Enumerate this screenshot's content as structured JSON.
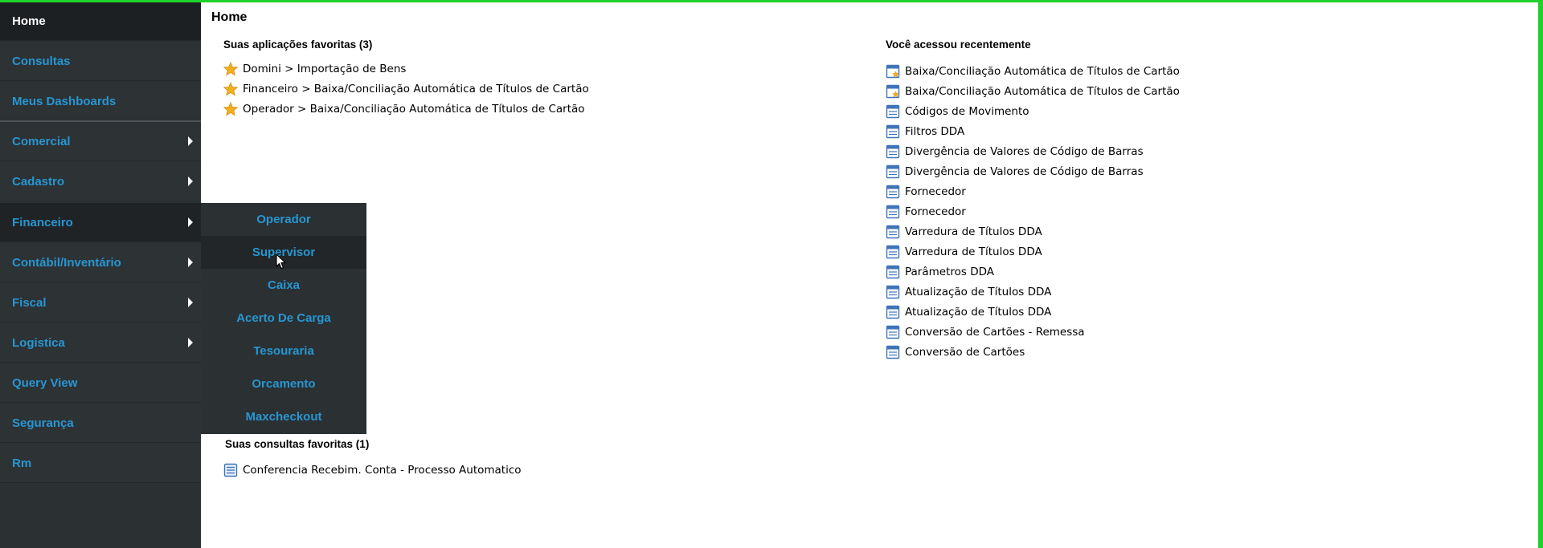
{
  "sidebar": {
    "items": [
      {
        "label": "Home"
      },
      {
        "label": "Consultas"
      },
      {
        "label": "Meus Dashboards"
      },
      {
        "label": "Comercial"
      },
      {
        "label": "Cadastro"
      },
      {
        "label": "Financeiro"
      },
      {
        "label": "Contábil/Inventário"
      },
      {
        "label": "Fiscal"
      },
      {
        "label": "Logistica"
      },
      {
        "label": "Query View"
      },
      {
        "label": "Segurança"
      },
      {
        "label": "Rm"
      }
    ]
  },
  "submenu": {
    "items": [
      {
        "label": "Operador"
      },
      {
        "label": "Supervisor"
      },
      {
        "label": "Caixa"
      },
      {
        "label": "Acerto De Carga"
      },
      {
        "label": "Tesouraria"
      },
      {
        "label": "Orcamento"
      },
      {
        "label": "Maxcheckout"
      }
    ]
  },
  "main": {
    "title": "Home",
    "favorites": {
      "title": "Suas aplicações favoritas (3)",
      "items": [
        "Domini > Importação de Bens",
        "Financeiro > Baixa/Conciliação Automática de Títulos de Cartão",
        "Operador > Baixa/Conciliação Automática de Títulos de Cartão"
      ]
    },
    "recent": {
      "title": "Você acessou recentemente",
      "items": [
        "Baixa/Conciliação Automática de Títulos de Cartão",
        "Baixa/Conciliação Automática de Títulos de Cartão",
        "Códigos de Movimento",
        "Filtros DDA",
        "Divergência de Valores de Código de Barras",
        "Divergência de Valores de Código de Barras",
        "Fornecedor",
        "Fornecedor",
        "Varredura de Títulos DDA",
        "Varredura de Títulos DDA",
        "Parâmetros DDA",
        "Atualização de Títulos DDA",
        "Atualização de Títulos DDA",
        "Conversão de Cartões - Remessa",
        "Conversão de Cartões"
      ]
    },
    "queries": {
      "title": "Suas consultas favoritas (1)",
      "items": [
        "Conferencia Recebim. Conta - Processo Automatico"
      ]
    }
  },
  "colors": {
    "sidebar_bg": "#2b3033",
    "link_blue": "#2796d2",
    "window_border": "#1fd22b",
    "star": "#f2b01e"
  }
}
